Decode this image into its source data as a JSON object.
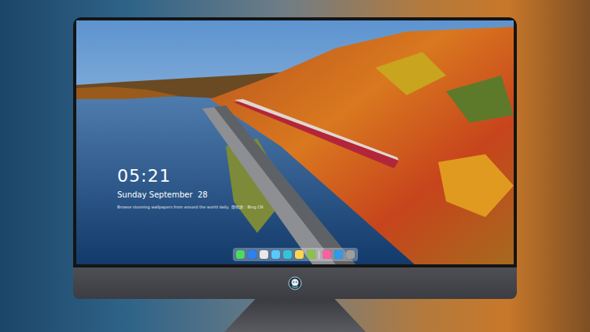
{
  "desktop": {
    "time": "05:21",
    "date": "Sunday September  28",
    "caption": "Browse stunning wallpapers from around the world daily.  壁纸源：Bing CN",
    "dock": {
      "items": [
        {
          "kind": "app",
          "color": "#4cd964"
        },
        {
          "kind": "app",
          "color": "#2f80ed"
        },
        {
          "kind": "app",
          "color": "#e8e8e8"
        },
        {
          "kind": "app",
          "color": "#5ac8fa"
        },
        {
          "kind": "app",
          "color": "#34c3d6"
        },
        {
          "kind": "app",
          "color": "#ffd54f"
        },
        {
          "kind": "app",
          "color": "#8bc34a"
        },
        {
          "kind": "separator"
        },
        {
          "kind": "app",
          "color": "#ff5fa2"
        },
        {
          "kind": "app",
          "color": "#2d9cf0"
        },
        {
          "kind": "app",
          "color": "#9e9e9e"
        }
      ]
    }
  }
}
